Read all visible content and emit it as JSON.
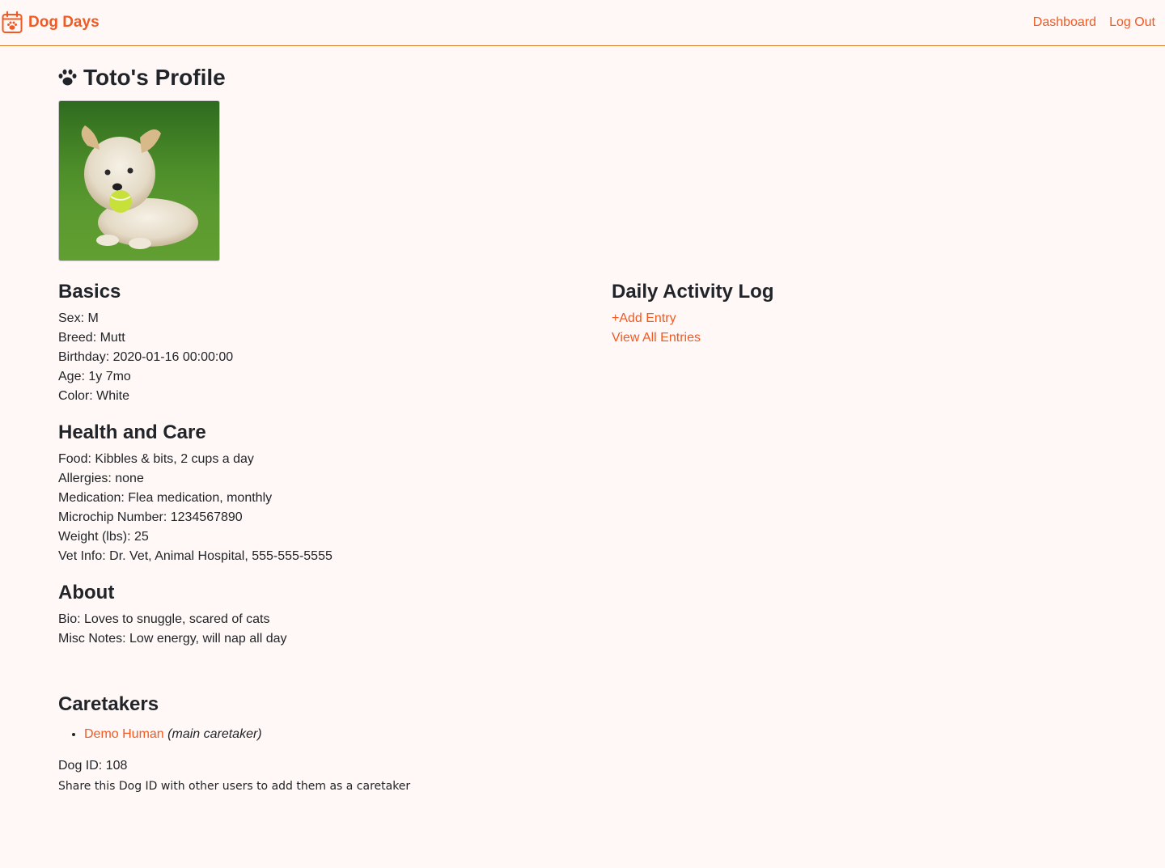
{
  "navbar": {
    "brand": "Dog Days",
    "brand_icon": "calendar-paw-icon",
    "links": [
      "Dashboard",
      "Log Out"
    ]
  },
  "profile": {
    "title": "Toto's Profile",
    "title_icon": "paw-icon",
    "photo_icon": "dog-photo"
  },
  "basics": {
    "heading": "Basics",
    "fields": [
      "Sex: M",
      "Breed: Mutt",
      "Birthday: 2020-01-16 00:00:00",
      "Age: 1y 7mo",
      "Color: White"
    ]
  },
  "health": {
    "heading": "Health and Care",
    "fields": [
      "Food: Kibbles & bits, 2 cups a day",
      "Allergies: none",
      "Medication: Flea medication, monthly",
      "Microchip Number: 1234567890",
      "Weight (lbs): 25",
      "Vet Info: Dr. Vet, Animal Hospital, 555-555-5555"
    ]
  },
  "about": {
    "heading": "About",
    "fields": [
      "Bio: Loves to snuggle, scared of cats",
      "Misc Notes: Low energy, will nap all day"
    ]
  },
  "activity_log": {
    "heading": "Daily Activity Log",
    "add_entry": "+Add Entry",
    "view_all": "View All Entries"
  },
  "caretakers": {
    "heading": "Caretakers",
    "items": [
      {
        "name": "Demo Human",
        "role": "(main caretaker)"
      }
    ]
  },
  "dog_id": {
    "text": "Dog ID: 108",
    "note": "Share this Dog ID with other users to add them as a caretaker"
  },
  "colors": {
    "accent": "#f15a22",
    "background": "#fff8f7",
    "divider": "#d9822b"
  }
}
